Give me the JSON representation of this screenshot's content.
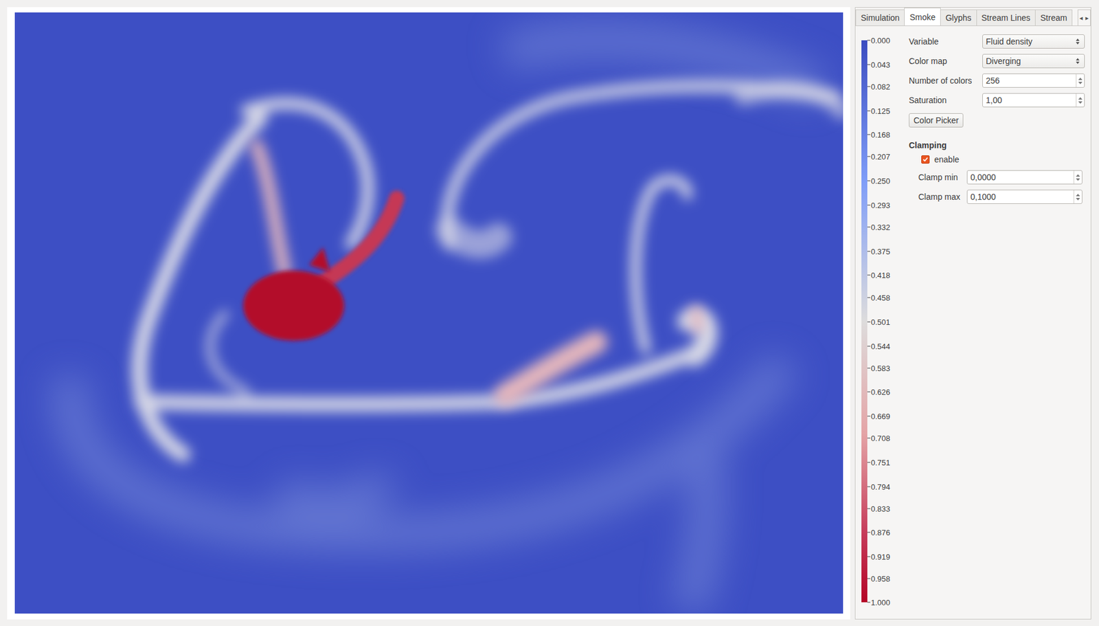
{
  "tabs": [
    {
      "label": "Simulation",
      "selected": false
    },
    {
      "label": "Smoke",
      "selected": true
    },
    {
      "label": "Glyphs",
      "selected": false
    },
    {
      "label": "Stream Lines",
      "selected": false
    },
    {
      "label": "Stream",
      "selected": false
    }
  ],
  "tab_scroll": [
    "◂",
    "▸"
  ],
  "legend": {
    "ticks": [
      "0.000",
      "0.043",
      "0.082",
      "0.125",
      "0.168",
      "0.207",
      "0.250",
      "0.293",
      "0.332",
      "0.375",
      "0.418",
      "0.458",
      "0.501",
      "0.544",
      "0.583",
      "0.626",
      "0.669",
      "0.708",
      "0.751",
      "0.794",
      "0.833",
      "0.876",
      "0.919",
      "0.958",
      "1.000"
    ]
  },
  "fields": [
    {
      "label": "Variable",
      "value": "Fluid density",
      "kind": "select"
    },
    {
      "label": "Color map",
      "value": "Diverging",
      "kind": "select"
    },
    {
      "label": "Number of colors",
      "value": "256",
      "kind": "spin"
    },
    {
      "label": "Saturation",
      "value": "1,00",
      "kind": "spin"
    }
  ],
  "color_picker_button": "Color Picker",
  "clamping": {
    "title": "Clamping",
    "enable": {
      "label": "enable",
      "checked": true
    },
    "fields": [
      {
        "label": "Clamp min",
        "value": "0,0000"
      },
      {
        "label": "Clamp max",
        "value": "0,1000"
      }
    ]
  }
}
